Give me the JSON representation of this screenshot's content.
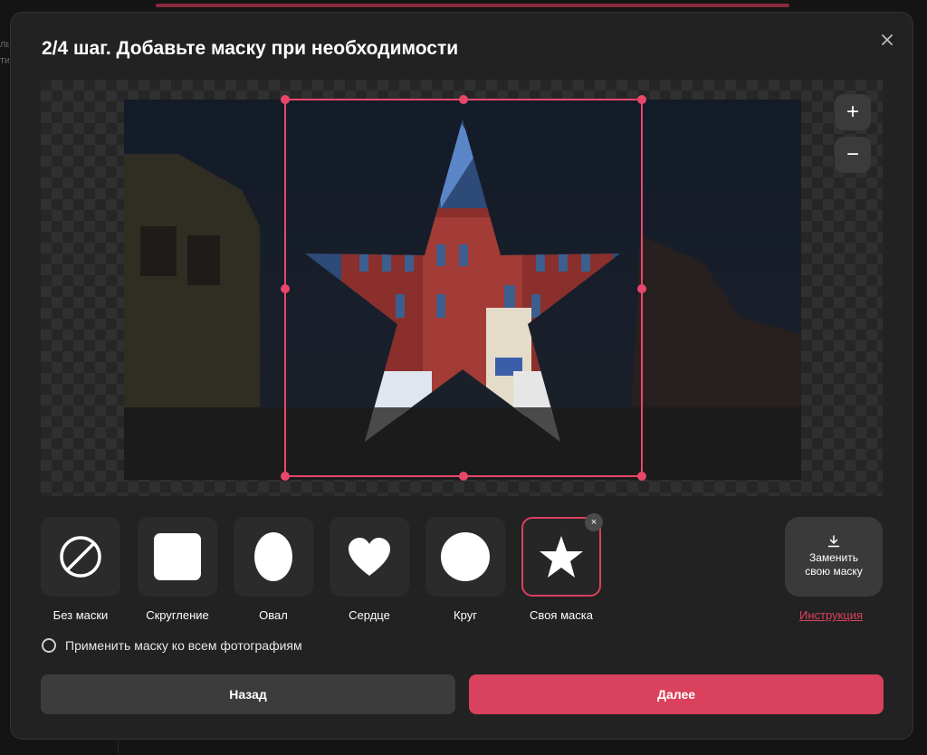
{
  "background": {
    "left_text": "ль\nти"
  },
  "modal": {
    "title": "2/4 шаг. Добавьте маску при необходимости",
    "close_icon": "close-icon"
  },
  "canvas": {
    "zoom_in_label": "+",
    "zoom_out_label": "−",
    "selection_color": "#e8476a"
  },
  "masks": [
    {
      "label": "Без маски",
      "icon": "no-mask-icon"
    },
    {
      "label": "Скругление",
      "icon": "rounded-square-icon"
    },
    {
      "label": "Овал",
      "icon": "oval-icon"
    },
    {
      "label": "Сердце",
      "icon": "heart-icon"
    },
    {
      "label": "Круг",
      "icon": "circle-icon"
    },
    {
      "label": "Своя маска",
      "icon": "star-icon",
      "selected": true
    }
  ],
  "remove_label": "×",
  "replace_mask": {
    "label": "Заменить своя маску",
    "line1": "Заменить",
    "line2": "свою маску",
    "icon": "download-icon"
  },
  "instruction_link": "Инструкция",
  "apply_all_label": "Применить маску ко всем фотографиям",
  "buttons": {
    "back": "Назад",
    "next": "Далее"
  },
  "colors": {
    "accent": "#d9415c",
    "modal_bg": "#222222",
    "tile_bg": "#2b2b2b"
  }
}
